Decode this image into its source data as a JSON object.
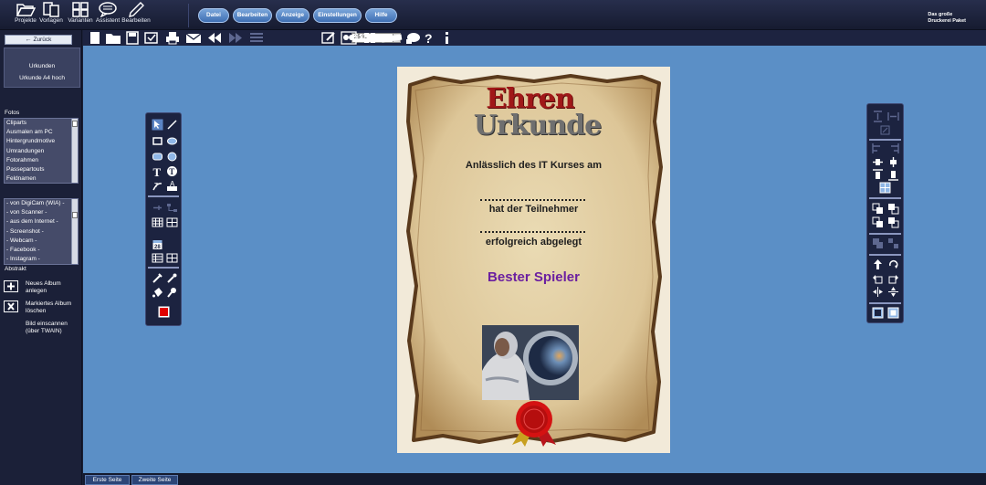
{
  "topbar": {
    "big_buttons": [
      {
        "label": "Projekte",
        "icon": "folder-open-icon"
      },
      {
        "label": "Vorlagen",
        "icon": "copy-icon"
      },
      {
        "label": "Varianten",
        "icon": "grid-icon"
      },
      {
        "label": "Assistent",
        "icon": "speech-bubble-icon"
      },
      {
        "label": "Bearbeiten",
        "icon": "pen-icon"
      }
    ],
    "menu": [
      "Datei",
      "Bearbeiten",
      "Anzeige",
      "Einstellungen",
      "Hilfe"
    ],
    "brand_line1": "Das große",
    "brand_line2": "Druckerei Paket"
  },
  "sidebar": {
    "back_label": "Zurück",
    "doc_category": "Urkunden",
    "doc_format": "Urkunde A4 hoch",
    "list_title": "Fotos",
    "album_list": [
      "Cliparts",
      "Ausmalen am PC",
      "Hintergrundmotive",
      "Umrandungen",
      "Fotorahmen",
      "Passepartouts",
      "Feldnamen"
    ],
    "source_list": [
      "- von DigiCam (WIA) -",
      "- von Scanner -",
      "- aus dem Internet -",
      "- Screenshot -",
      "- Webcam -",
      "- Facebook -",
      "- Instagram -"
    ],
    "current_album": "Abstrakt",
    "actions": [
      {
        "label": "Neues Album anlegen",
        "icon": "new-album-icon"
      },
      {
        "label": "Markiertes Album löschen",
        "icon": "delete-album-icon"
      },
      {
        "label": "Bild einscannen (über TWAIN)",
        "icon": ""
      }
    ]
  },
  "toolbar2": {
    "zoom": "25 %",
    "zoom_options": [
      "25 %"
    ]
  },
  "certificate": {
    "title_line1": "Ehren",
    "title_line2": "Urkunde",
    "line_intro": "Anlässlich des IT Kurses am",
    "line_participant": "hat der Teilnehmer",
    "line_completed": "erfolgreich abgelegt",
    "award": "Bester Spieler",
    "colors": {
      "title_red": "#a01818",
      "title_gray": "#6f6f6f",
      "award_purple": "#6b1fa0",
      "seal_red": "#d41212"
    }
  },
  "tabs": [
    "Erste Seite",
    "Zweite Seite"
  ],
  "colors": {
    "workspace": "#5b8fc6",
    "chrome": "#1a2036",
    "menu_button": "#4f7fc2"
  }
}
